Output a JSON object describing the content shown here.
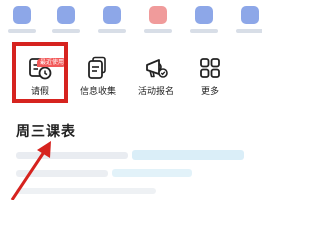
{
  "top_row": {
    "icon_colors": [
      "#2f5fd6",
      "#2f5fd6",
      "#2f5fd6",
      "#e44848",
      "#2f5fd6",
      "#2f5fd6"
    ]
  },
  "grid": [
    {
      "label": "请假",
      "icon": "leave-clock-icon",
      "badge": "最近使用"
    },
    {
      "label": "信息收集",
      "icon": "info-collect-icon"
    },
    {
      "label": "活动报名",
      "icon": "activity-signup-icon"
    },
    {
      "label": "更多",
      "icon": "more-grid-icon"
    }
  ],
  "section": {
    "title": "周三课表"
  },
  "colors": {
    "highlight": "#d6231f",
    "arrow": "#d6231f",
    "badge": "#f25a5a"
  }
}
